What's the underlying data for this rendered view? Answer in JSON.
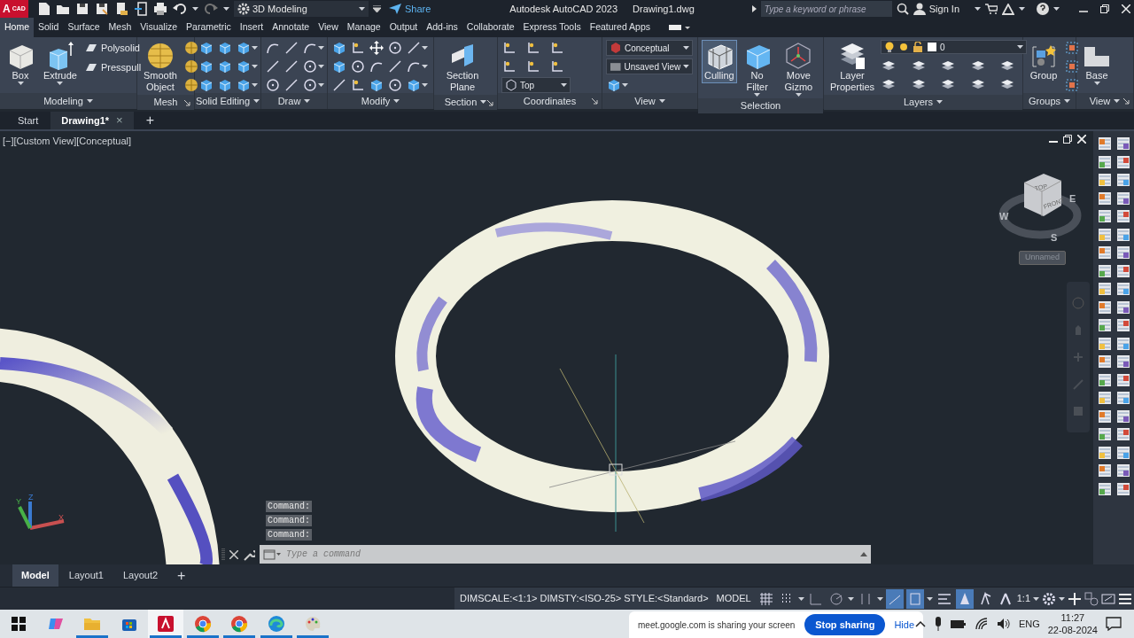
{
  "title_bar": {
    "logo": {
      "letter": "A",
      "caption": "CAD"
    },
    "workspace": "3D Modeling",
    "share": "Share",
    "app_title": "Autodesk AutoCAD 2023",
    "file_name": "Drawing1.dwg",
    "search_placeholder": "Type a keyword or phrase",
    "sign_in": "Sign In"
  },
  "ribbon_tabs": [
    {
      "label": "Home",
      "selected": true
    },
    {
      "label": "Solid",
      "selected": false
    },
    {
      "label": "Surface",
      "selected": false
    },
    {
      "label": "Mesh",
      "selected": false
    },
    {
      "label": "Visualize",
      "selected": false
    },
    {
      "label": "Parametric",
      "selected": false
    },
    {
      "label": "Insert",
      "selected": false
    },
    {
      "label": "Annotate",
      "selected": false
    },
    {
      "label": "View",
      "selected": false
    },
    {
      "label": "Manage",
      "selected": false
    },
    {
      "label": "Output",
      "selected": false
    },
    {
      "label": "Add-ins",
      "selected": false
    },
    {
      "label": "Collaborate",
      "selected": false
    },
    {
      "label": "Express Tools",
      "selected": false
    },
    {
      "label": "Featured Apps",
      "selected": false
    }
  ],
  "ribbon_panels": [
    {
      "title": "Modeling",
      "menu": true,
      "launcher": false,
      "items": [
        {
          "kind": "large",
          "label": "Box",
          "menu": true,
          "pressed": false
        },
        {
          "kind": "large",
          "label": "Extrude",
          "menu": true,
          "pressed": false
        },
        {
          "kind": "stack",
          "items": [
            {
              "kind": "small",
              "label": "Polysolid"
            },
            {
              "kind": "small",
              "label": "Presspull"
            }
          ]
        }
      ]
    },
    {
      "title": "Mesh",
      "menu": false,
      "launcher": true,
      "items": [
        {
          "kind": "large",
          "label": "Smooth Object",
          "menu": false,
          "pressed": false
        },
        {
          "kind": "icons"
        }
      ]
    },
    {
      "title": "Solid Editing",
      "menu": true,
      "launcher": false,
      "items": [
        {
          "kind": "icons"
        }
      ]
    },
    {
      "title": "Draw",
      "menu": true,
      "launcher": false,
      "items": [
        {
          "kind": "icons"
        }
      ]
    },
    {
      "title": "Modify",
      "menu": true,
      "launcher": false,
      "items": [
        {
          "kind": "icons"
        }
      ]
    },
    {
      "title": "Section",
      "menu": true,
      "launcher": true,
      "items": [
        {
          "kind": "large",
          "label": "Section Plane",
          "menu": false,
          "pressed": false
        }
      ]
    },
    {
      "title": "Coordinates",
      "menu": false,
      "launcher": true,
      "items": [
        {
          "kind": "stack",
          "items": [
            {
              "kind": "icons"
            },
            {
              "kind": "dropdown",
              "value": "Top"
            }
          ]
        }
      ]
    },
    {
      "title": "View",
      "menu": true,
      "launcher": false,
      "items": [
        {
          "kind": "stack",
          "items": [
            {
              "kind": "dropdown",
              "value": "Conceptual"
            },
            {
              "kind": "dropdown",
              "value": "Unsaved View"
            },
            {
              "kind": "icons"
            }
          ]
        }
      ]
    },
    {
      "title": "Selection",
      "menu": false,
      "launcher": false,
      "items": [
        {
          "kind": "large",
          "label": "Culling",
          "menu": false,
          "pressed": true
        },
        {
          "kind": "large",
          "label": "No Filter",
          "menu": true,
          "pressed": false
        },
        {
          "kind": "large",
          "label": "Move Gizmo",
          "menu": true,
          "pressed": false
        }
      ]
    },
    {
      "title": "Layers",
      "menu": true,
      "launcher": false,
      "items": [
        {
          "kind": "large",
          "label": "Layer Properties",
          "menu": false,
          "pressed": false
        },
        {
          "kind": "stack",
          "items": [
            {
              "kind": "dropdown",
              "value": "0"
            },
            {
              "kind": "icons"
            }
          ]
        }
      ]
    },
    {
      "title": "Groups",
      "menu": true,
      "launcher": false,
      "items": [
        {
          "kind": "large",
          "label": "Group",
          "menu": false,
          "pressed": false
        },
        {
          "kind": "icons"
        }
      ]
    },
    {
      "title": "View",
      "menu": true,
      "launcher": true,
      "items": [
        {
          "kind": "large",
          "label": "Base",
          "menu": true,
          "pressed": false
        }
      ]
    }
  ],
  "file_tabs": [
    {
      "label": "Start",
      "selected": false
    },
    {
      "label": "Drawing1*",
      "selected": true,
      "close": "×"
    }
  ],
  "new_file_tab": "+",
  "viewport": {
    "label": "[−][Custom View][Conceptual]",
    "viewcube": {
      "top": "TOP",
      "front": "FRONT",
      "west": "W",
      "east": "E",
      "south": "S",
      "view_name": "Unnamed"
    },
    "ucs": {
      "x": "X",
      "y": "Y",
      "z": "Z"
    }
  },
  "command_history": [
    "Command:",
    "Command:",
    "Command:"
  ],
  "command_line": {
    "placeholder": "Type a command"
  },
  "layout_tabs": [
    {
      "label": "Model",
      "selected": true
    },
    {
      "label": "Layout1",
      "selected": false
    },
    {
      "label": "Layout2",
      "selected": false
    }
  ],
  "new_layout_tab": "+",
  "status_bar": {
    "annotation_info": [
      "DIMSCALE:<1:1>",
      "DIMSTY:<ISO-25>",
      "STYLE:<Standard>"
    ],
    "space": "MODEL",
    "toggles": [
      {
        "on": false
      },
      {
        "on": false
      },
      {
        "on": false
      },
      {
        "on": false
      },
      {
        "on": false
      },
      {
        "on": true
      },
      {
        "on": true
      },
      {
        "on": false
      },
      {
        "on": true
      },
      {
        "on": false
      },
      {
        "on": false
      }
    ],
    "scale": "1:1"
  },
  "taskbar": {
    "apps": [
      {
        "selected": false,
        "running": false
      },
      {
        "selected": false,
        "running": false
      },
      {
        "selected": false,
        "running": true
      },
      {
        "selected": false,
        "running": false
      },
      {
        "selected": true,
        "running": true
      },
      {
        "selected": false,
        "running": true
      },
      {
        "selected": false,
        "running": true
      },
      {
        "selected": false,
        "running": true
      },
      {
        "selected": false,
        "running": true
      }
    ],
    "sharing": {
      "message": "meet.google.com is sharing your screen",
      "stop": "Stop sharing",
      "hide": "Hide"
    },
    "language": "ENG",
    "time": "11:27",
    "date": "22-08-2024"
  }
}
